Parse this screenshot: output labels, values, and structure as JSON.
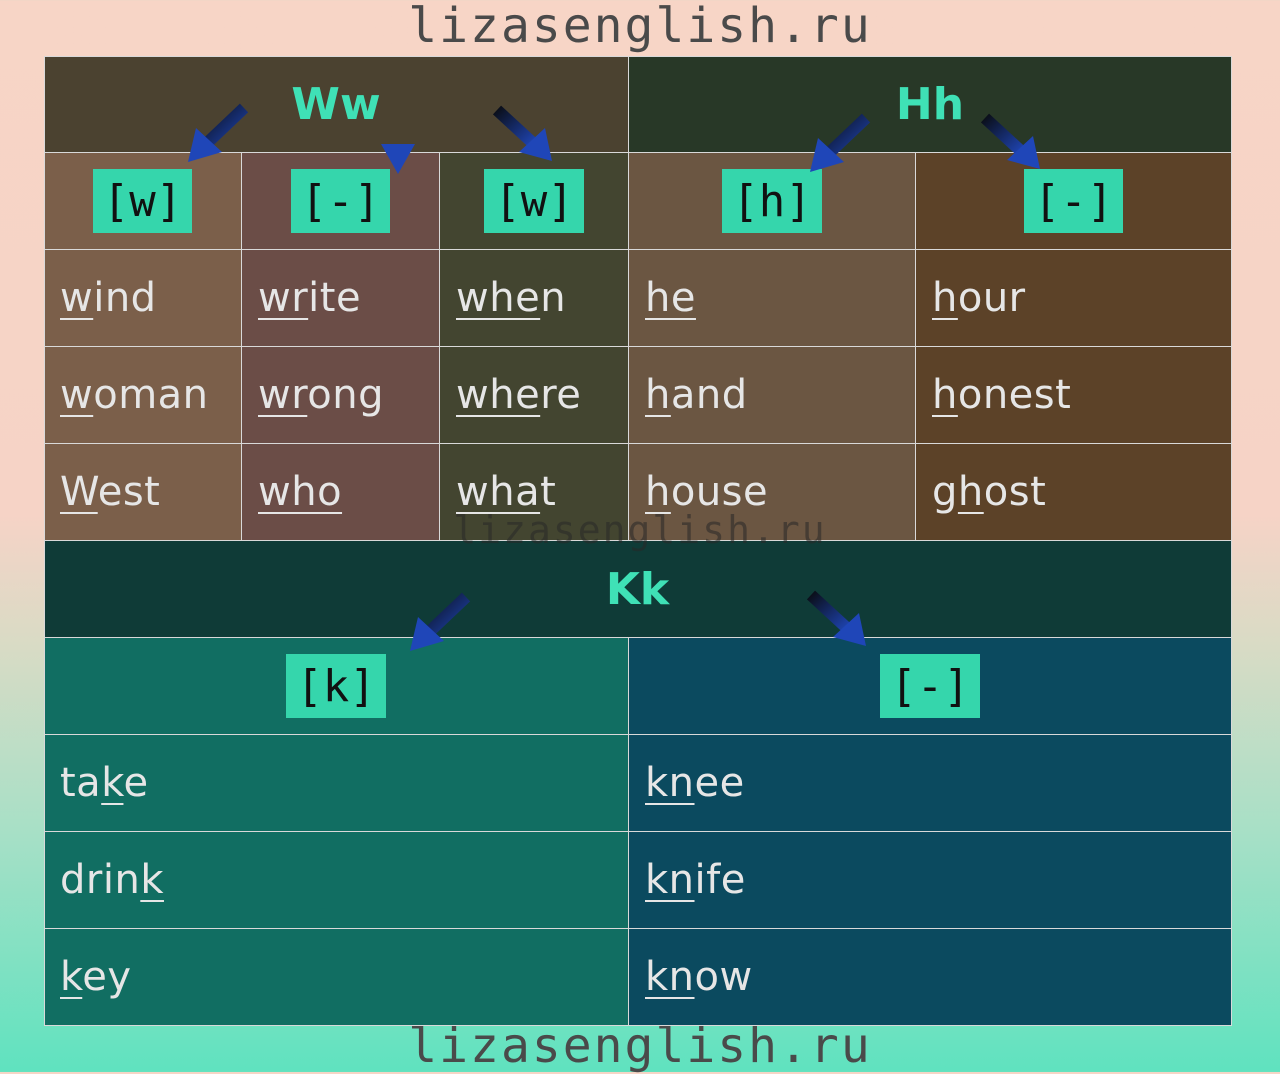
{
  "watermark": "lizasenglish.ru",
  "colors": {
    "ww_header": "#4b4230",
    "hh_header": "#283827",
    "kk_header": "#0f3b37",
    "ww_col1": "#7b5f4a",
    "ww_col2": "#6b4d47",
    "ww_col3": "#434530",
    "hh_col1": "#6b5642",
    "hh_col2": "#5c4228",
    "kk_col1": "#116e62",
    "kk_col2": "#0b4a5f",
    "heading_text": "#3fe1b6",
    "phoneme_bg": "#35d6ac",
    "arrow": "#1f3fa0"
  },
  "sections": {
    "ww": {
      "title": "Ww",
      "columns": [
        {
          "phoneme": "[w]",
          "words": [
            [
              {
                "t": "w",
                "u": true
              },
              {
                "t": "ind",
                "u": false
              }
            ],
            [
              {
                "t": "w",
                "u": true
              },
              {
                "t": "oman",
                "u": false
              }
            ],
            [
              {
                "t": "W",
                "u": true
              },
              {
                "t": "est",
                "u": false
              }
            ]
          ]
        },
        {
          "phoneme": "[-]",
          "words": [
            [
              {
                "t": "wr",
                "u": true
              },
              {
                "t": "ite",
                "u": false
              }
            ],
            [
              {
                "t": "wr",
                "u": true
              },
              {
                "t": "ong",
                "u": false
              }
            ],
            [
              {
                "t": "who",
                "u": true
              }
            ]
          ]
        },
        {
          "phoneme": "[w]",
          "words": [
            [
              {
                "t": "whe",
                "u": true
              },
              {
                "t": "n",
                "u": false
              }
            ],
            [
              {
                "t": "whe",
                "u": true
              },
              {
                "t": "re",
                "u": false
              }
            ],
            [
              {
                "t": "wha",
                "u": true
              },
              {
                "t": "t",
                "u": false
              }
            ]
          ]
        }
      ]
    },
    "hh": {
      "title": "Hh",
      "columns": [
        {
          "phoneme": "[h]",
          "words": [
            [
              {
                "t": "he",
                "u": true
              }
            ],
            [
              {
                "t": "h",
                "u": true
              },
              {
                "t": "and",
                "u": false
              }
            ],
            [
              {
                "t": "h",
                "u": true
              },
              {
                "t": "ouse",
                "u": false
              }
            ]
          ]
        },
        {
          "phoneme": "[-]",
          "words": [
            [
              {
                "t": "h",
                "u": true
              },
              {
                "t": "our",
                "u": false
              }
            ],
            [
              {
                "t": "h",
                "u": true
              },
              {
                "t": "onest",
                "u": false
              }
            ],
            [
              {
                "t": "g",
                "u": false
              },
              {
                "t": "h",
                "u": true
              },
              {
                "t": "ost",
                "u": false
              }
            ]
          ]
        }
      ]
    },
    "kk": {
      "title": "Kk",
      "columns": [
        {
          "phoneme": "[k]",
          "words": [
            [
              {
                "t": "ta",
                "u": false
              },
              {
                "t": "k",
                "u": true
              },
              {
                "t": "e",
                "u": false
              }
            ],
            [
              {
                "t": "drin",
                "u": false
              },
              {
                "t": "k",
                "u": true
              }
            ],
            [
              {
                "t": "k",
                "u": true
              },
              {
                "t": "ey",
                "u": false
              }
            ]
          ]
        },
        {
          "phoneme": "[-]",
          "words": [
            [
              {
                "t": "kn",
                "u": true
              },
              {
                "t": "ee",
                "u": false
              }
            ],
            [
              {
                "t": "kn",
                "u": true
              },
              {
                "t": "ife",
                "u": false
              }
            ],
            [
              {
                "t": "kn",
                "u": true
              },
              {
                "t": "ow",
                "u": false
              }
            ]
          ]
        }
      ]
    }
  }
}
